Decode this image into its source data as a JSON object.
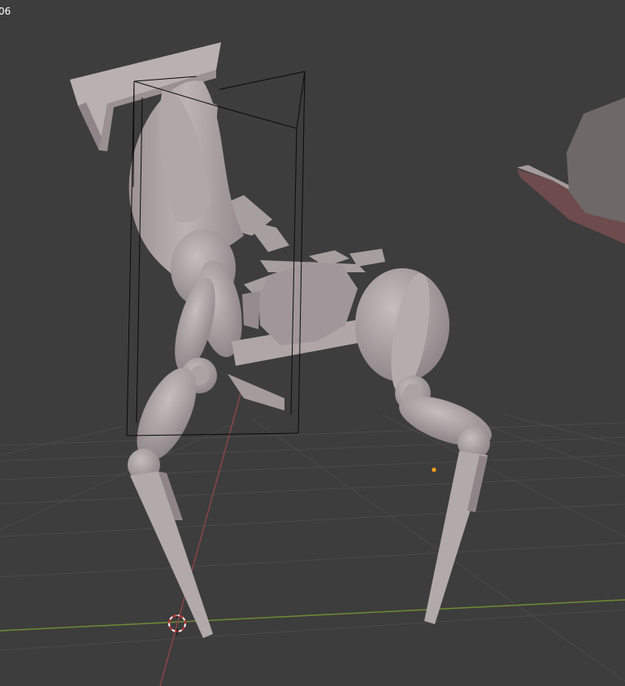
{
  "viewport": {
    "corner_text": "06",
    "background": "#3d3d3d",
    "grid_color": "#4b4b4b",
    "x_axis_color": "#7a9a3c",
    "y_axis_color": "#9a4a4a",
    "object_color": "#b2a9aa",
    "object_shadow": "#8f8588",
    "bbox_color": "#000000",
    "origin_color": "#f0a020"
  },
  "scene": {
    "objects": [
      {
        "name": "robot-legs-mesh",
        "type": "mesh"
      },
      {
        "name": "partial-mesh-right",
        "type": "mesh"
      },
      {
        "name": "bounding-box-wireframe",
        "type": "wireframe"
      },
      {
        "name": "3d-cursor",
        "type": "cursor"
      },
      {
        "name": "object-origin",
        "type": "origin"
      }
    ]
  }
}
